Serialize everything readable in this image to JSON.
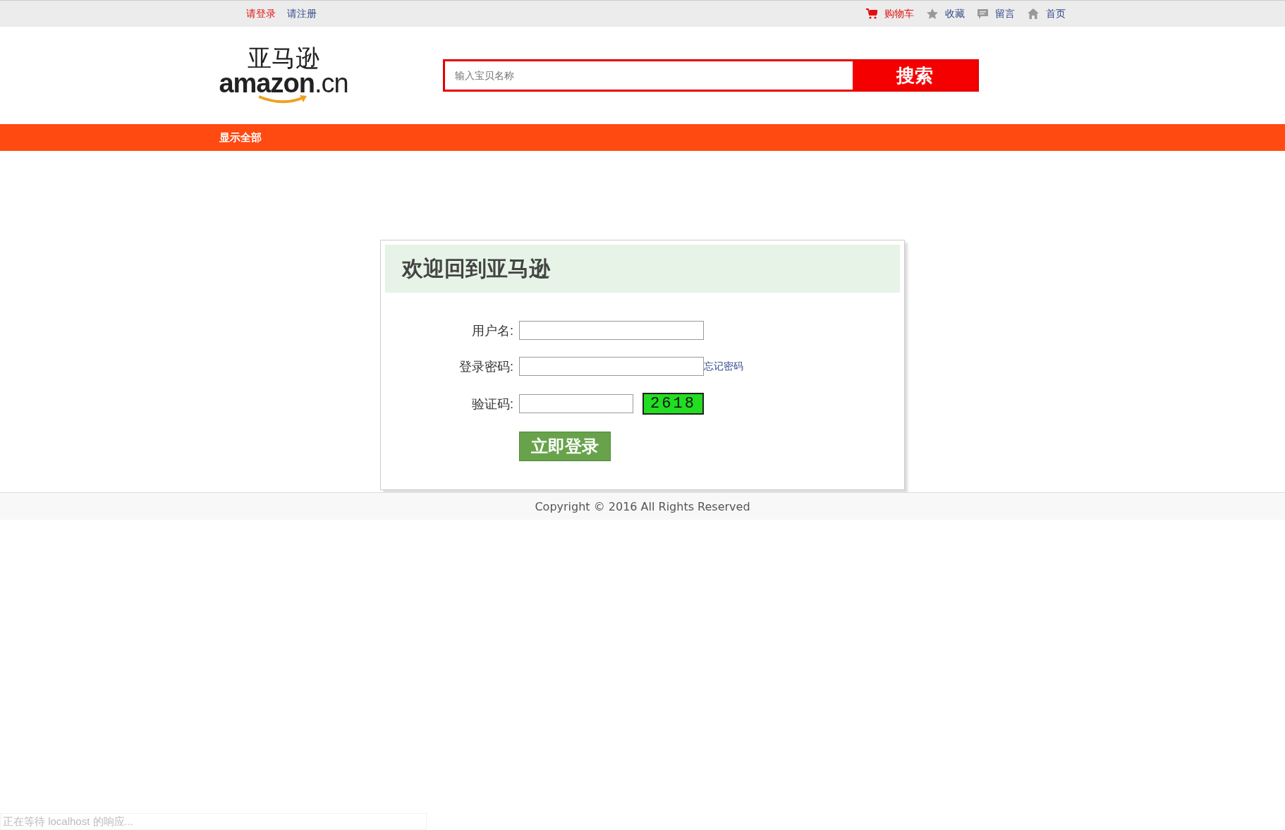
{
  "top_bar": {
    "left_links": [
      {
        "label": "请登录",
        "highlighted": true
      },
      {
        "label": "请注册",
        "highlighted": false
      }
    ],
    "right_links": [
      {
        "kind": "cart",
        "label": "购物车",
        "highlighted": true
      },
      {
        "kind": "star",
        "label": "收藏",
        "highlighted": false
      },
      {
        "kind": "comment",
        "label": "留言",
        "highlighted": false
      },
      {
        "kind": "home",
        "label": "首页",
        "highlighted": false
      }
    ]
  },
  "logo": {
    "chinese": "亚马逊",
    "latin": "amazon",
    "suffix": ".cn"
  },
  "search": {
    "placeholder": "输入宝贝名称",
    "button": "搜索"
  },
  "nav": {
    "items": [
      "显示全部"
    ]
  },
  "login": {
    "title": "欢迎回到亚马逊",
    "fields": [
      {
        "kind": "text",
        "label": "用户名:"
      },
      {
        "kind": "password",
        "label": "登录密码:",
        "link": "忘记密码"
      },
      {
        "kind": "captcha",
        "label": "验证码:",
        "code": "2618"
      }
    ],
    "submit": "立即登录"
  },
  "footer": {
    "copyright": "Copyright © 2016 All Rights Reserved"
  },
  "status_bar": {
    "text": "正在等待 localhost 的响应..."
  }
}
